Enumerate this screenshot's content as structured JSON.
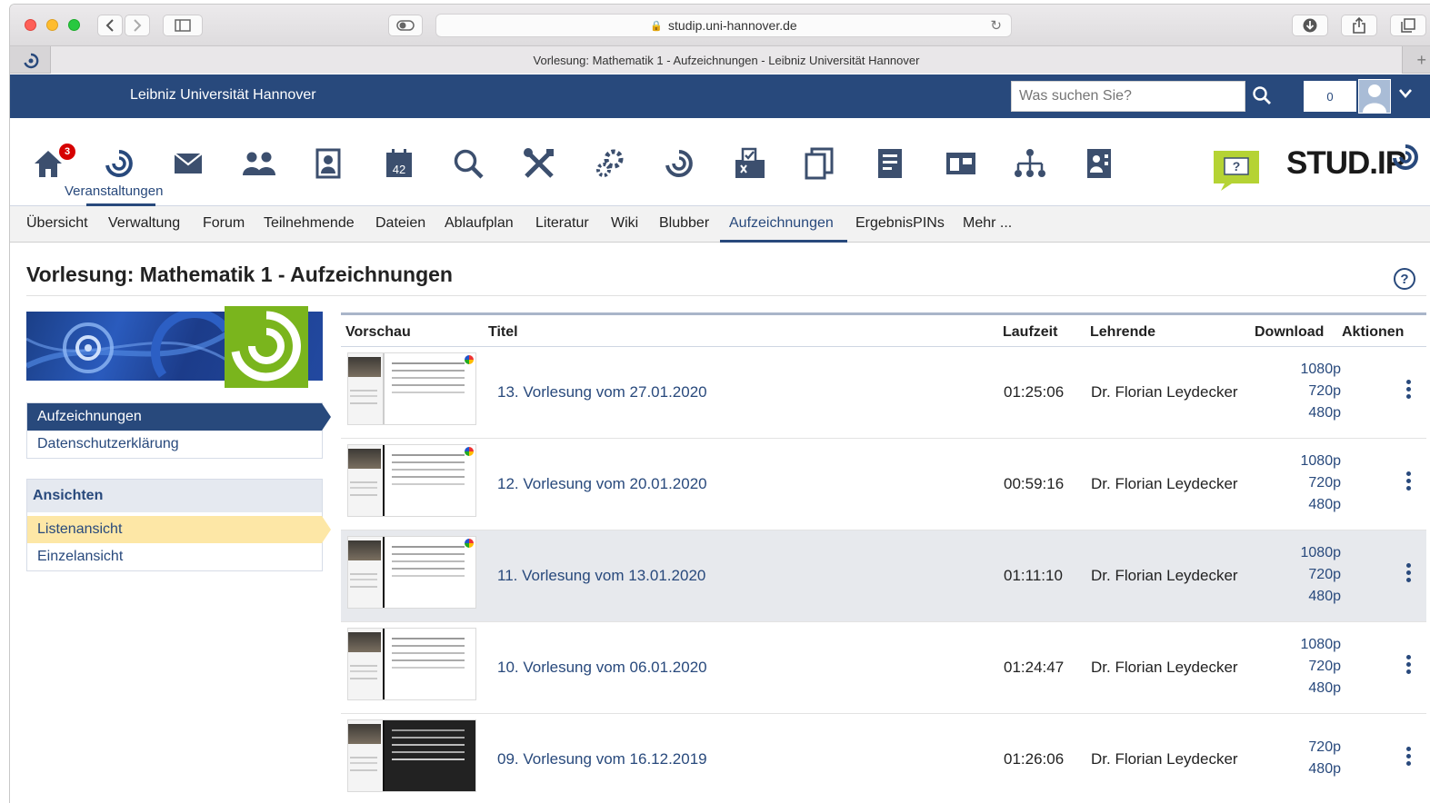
{
  "browser": {
    "url": "studip.uni-hannover.de",
    "tab_title": "Vorlesung: Mathematik 1 - Aufzeichnungen - Leibniz Universität Hannover"
  },
  "header": {
    "university": "Leibniz Universität Hannover",
    "search_placeholder": "Was suchen Sie?",
    "notification_count": "0"
  },
  "iconnav": {
    "badge": "3",
    "active_label": "Veranstaltungen",
    "logo_text_big": "STUD.IP"
  },
  "subnav": {
    "tabs": [
      "Übersicht",
      "Verwaltung",
      "Forum",
      "Teilnehmende",
      "Dateien",
      "Ablaufplan",
      "Literatur",
      "Wiki",
      "Blubber",
      "Aufzeichnungen",
      "ErgebnisPINs",
      "Mehr ..."
    ]
  },
  "page": {
    "title": "Vorlesung: Mathematik 1 - Aufzeichnungen",
    "help": "?"
  },
  "sidebar": {
    "nav": [
      "Aufzeichnungen",
      "Datenschutzerklärung"
    ],
    "views_heading": "Ansichten",
    "views": [
      "Listenansicht",
      "Einzelansicht"
    ]
  },
  "table": {
    "headers": [
      "Vorschau",
      "Titel",
      "Laufzeit",
      "Lehrende",
      "Download",
      "Aktionen"
    ],
    "rows": [
      {
        "title": "13. Vorlesung vom 27.01.2020",
        "duration": "01:25:06",
        "teacher": "Dr. Florian Leydecker",
        "downloads": [
          "1080p",
          "720p",
          "480p"
        ]
      },
      {
        "title": "12. Vorlesung vom 20.01.2020",
        "duration": "00:59:16",
        "teacher": "Dr. Florian Leydecker",
        "downloads": [
          "1080p",
          "720p",
          "480p"
        ]
      },
      {
        "title": "11. Vorlesung vom 13.01.2020",
        "duration": "01:11:10",
        "teacher": "Dr. Florian Leydecker",
        "downloads": [
          "1080p",
          "720p",
          "480p"
        ]
      },
      {
        "title": "10. Vorlesung vom 06.01.2020",
        "duration": "01:24:47",
        "teacher": "Dr. Florian Leydecker",
        "downloads": [
          "1080p",
          "720p",
          "480p"
        ]
      },
      {
        "title": "09. Vorlesung vom 16.12.2019",
        "duration": "01:26:06",
        "teacher": "Dr. Florian Leydecker",
        "downloads": [
          "720p",
          "480p"
        ]
      }
    ]
  },
  "colors": {
    "brand_blue": "#28497c",
    "selection_yellow": "#fde7a6",
    "green": "#7ab51d"
  }
}
